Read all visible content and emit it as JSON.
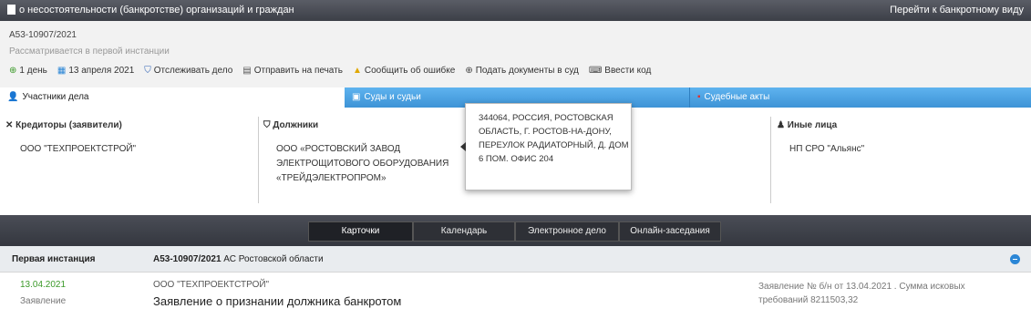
{
  "topbar": {
    "title": "о несостоятельности (банкротстве) организаций и граждан",
    "switch_view": "Перейти к банкротному виду"
  },
  "case": {
    "number": "А53-10907/2021",
    "status": "Рассматривается в первой инстанции"
  },
  "toolbar": {
    "one_day": "1 день",
    "date": "13 апреля 2021",
    "track": "Отслеживать дело",
    "print": "Отправить на печать",
    "report_error": "Сообщить об ошибке",
    "submit_docs": "Подать документы в суд",
    "enter_code": "Ввести код"
  },
  "tabs": {
    "participants": "Участники дела",
    "courts": "Суды и судьи",
    "acts": "Судебные акты"
  },
  "participants": {
    "creditors_head": "Кредиторы (заявители)",
    "creditors_name": "ООО \"ТЕХПРОЕКТСТРОЙ\"",
    "debtor_head": "Должники",
    "debtor_name": "ООО «РОСТОВСКИЙ ЗАВОД ЭЛЕКТРОЩИТОВОГО ОБОРУДОВАНИЯ «ТРЕЙДЭЛЕКТРОПРОМ»",
    "others_head": "Иные лица",
    "others_name": "НП СРО \"Альянс\""
  },
  "popup": {
    "address": "344064, РОССИЯ, РОСТОВСКАЯ ОБЛАСТЬ, Г. РОСТОВ-НА-ДОНУ, ПЕРЕУЛОК РАДИАТОРНЫЙ, Д. ДОМ 6 ПОМ. ОФИС 204"
  },
  "view_tabs": {
    "cards": "Карточки",
    "calendar": "Календарь",
    "edoc": "Электронное дело",
    "online": "Онлайн-заседания"
  },
  "instance": {
    "label": "Первая инстанция",
    "case_number": "А53-10907/2021",
    "court": "АС Ростовской области"
  },
  "entry": {
    "date": "13.04.2021",
    "type": "Заявление",
    "org": "ООО \"ТЕХПРОЕКТСТРОЙ\"",
    "title": "Заявление о признании должника банкротом",
    "info": "Заявление № б/н от 13.04.2021 . Сумма исковых требований 8211503,32"
  },
  "colors": {
    "accent_blue": "#3d93d6",
    "dark_bar": "#3c3f47",
    "date_green": "#3c9a2a"
  }
}
